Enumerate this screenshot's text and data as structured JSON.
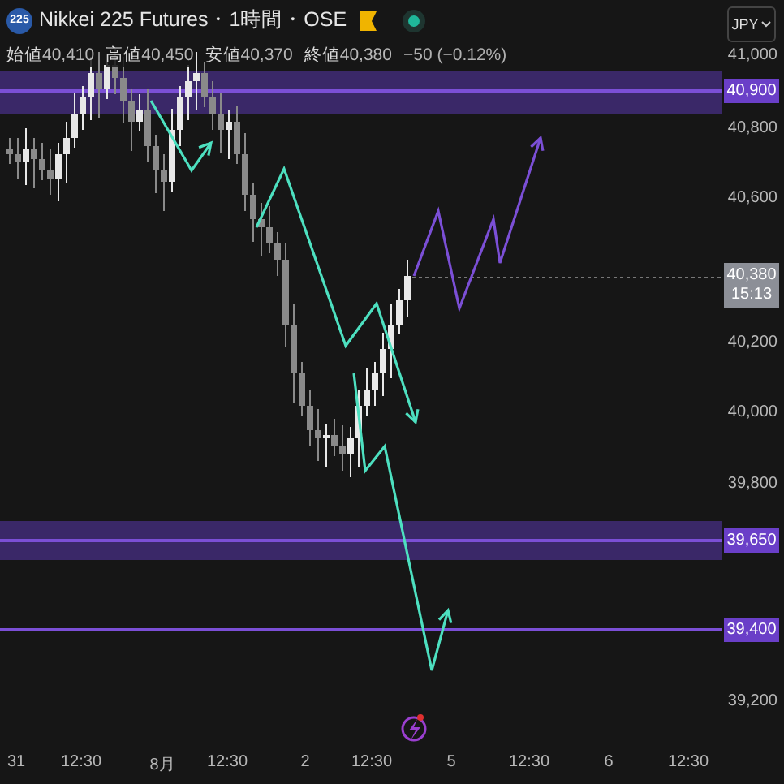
{
  "header": {
    "symbol_badge": "225",
    "title": "Nikkei 225 Futures・1時間・OSE",
    "currency": "JPY"
  },
  "ohlc": [
    {
      "label": "始値",
      "value": "40,410"
    },
    {
      "label": "高値",
      "value": "40,450"
    },
    {
      "label": "安値",
      "value": "40,370"
    },
    {
      "label": "終値",
      "value": "40,380"
    }
  ],
  "change": "−50 (−0.12%)",
  "price_axis": {
    "ticks": [
      "41,000",
      "40,800",
      "40,600",
      "40,200",
      "40,000",
      "39,800",
      "39,200"
    ],
    "marked": [
      "40,900",
      "39,650",
      "39,400"
    ],
    "current": {
      "price": "40,380",
      "countdown": "15:13"
    }
  },
  "time_axis": [
    "31",
    "12:30",
    "8月",
    "12:30",
    "2",
    "12:30",
    "5",
    "12:30",
    "6",
    "12:30"
  ]
}
